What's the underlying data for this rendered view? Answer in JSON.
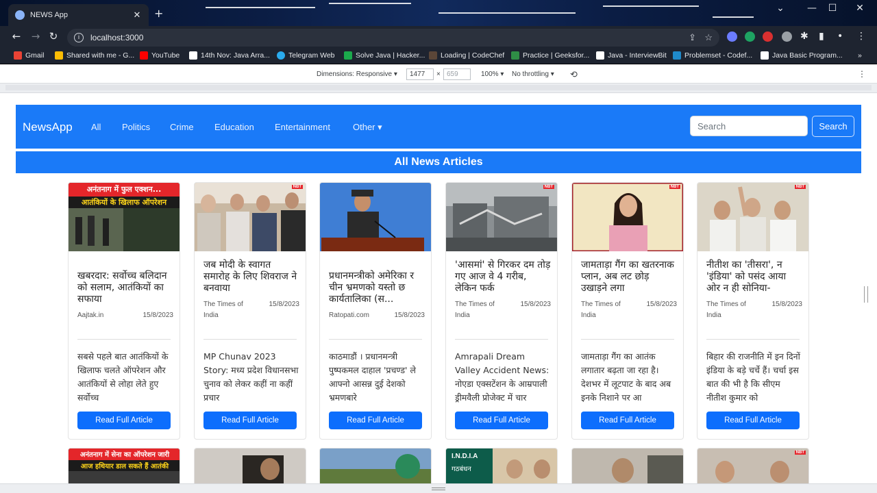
{
  "browser": {
    "tab_title": "NEWS App",
    "url": "localhost:3000",
    "bookmarks": [
      {
        "label": "Gmail",
        "color": "#ea4335"
      },
      {
        "label": "Shared with me - G...",
        "color": "#fbbc04"
      },
      {
        "label": "YouTube",
        "color": "#ff0000"
      },
      {
        "label": "14th Nov: Java Arra...",
        "color": "#ffffff"
      },
      {
        "label": "Telegram Web",
        "color": "#2aabee"
      },
      {
        "label": "Solve Java | Hacker...",
        "color": "#1ba94c"
      },
      {
        "label": "Loading | CodeChef",
        "color": "#5b4638"
      },
      {
        "label": "Practice | Geeksfor...",
        "color": "#2f8d46"
      },
      {
        "label": "Java - InterviewBit",
        "color": "#ffffff"
      },
      {
        "label": "Problemset - Codef...",
        "color": "#1f8acb"
      },
      {
        "label": "Java Basic Program...",
        "color": "#ffffff"
      }
    ]
  },
  "devtools": {
    "dimensions": "Dimensions: Responsive ▾",
    "width": "1477",
    "times": "×",
    "height": "659",
    "zoom": "100% ▾",
    "throttling": "No throttling ▾"
  },
  "navbar": {
    "brand": "NewsApp",
    "links": [
      "All",
      "Politics",
      "Crime",
      "Education",
      "Entertainment",
      "Other ▾"
    ],
    "search_placeholder": "Search",
    "search_button": "Search"
  },
  "heading": "All News Articles",
  "articles": [
    {
      "title": "खबरदार: सर्वोच्च बलिदान को सलाम, आतंकियों का सफाया",
      "source": "Aajtak.in",
      "date": "15/8/2023",
      "description": "सबसे पहले बात आतंकियों के खिलाफ चलते ऑपरेशन और आतंकियों से लोहा लेते हुए सर्वोच्च",
      "button": "Read Full Article",
      "image_caption_1": "अनंतनाग में फुल एक्शन...",
      "image_caption_2": "आतंकियों के खिलाफ ऑपरेशन"
    },
    {
      "title": "जब मोदी के स्वागत समारोह के लिए शिवराज ने बनवाया",
      "source": "The Times of India",
      "date": "15/8/2023",
      "description": "MP Chunav 2023 Story: मध्य प्रदेश विधानसभा चुनाव को लेकर कहीं ना कहीं प्रचार",
      "button": "Read Full Article"
    },
    {
      "title": "प्रधानमन्त्रीको अमेरिका र चीन भ्रमणको यस्तो छ कार्यतालिका (स...",
      "source": "Ratopati.com",
      "date": "15/8/2023",
      "description": "काठमाडौं । प्रधानमन्त्री पुष्पकमल दाहाल 'प्रचण्ड' ले आफ्नो आसन्न दुई देशको भ्रमणबारे",
      "button": "Read Full Article"
    },
    {
      "title": "'आसमां' से गिरकर दम तोड़ गए आज वे 4 गरीब, लेकिन फर्क",
      "source": "The Times of India",
      "date": "15/8/2023",
      "description": "Amrapali Dream Valley Accident News: नोएडा एक्सटेंशन के आम्रपाली ड्रीमवैली प्रोजेक्ट में चार",
      "button": "Read Full Article"
    },
    {
      "title": "जामताड़ा गैंग का खतरनाक प्लान, अब लट छोड़ उखाड़ने लगा",
      "source": "The Times of India",
      "date": "15/8/2023",
      "description": "जामताड़ा गैंग का आतंक लगातार बढ़ता जा रहा है। देशभर में लूटपाट के बाद अब इनके निशाने पर आ",
      "button": "Read Full Article"
    },
    {
      "title": "नीतीश का 'तीसरा', न 'इंडिया' को पसंद आया ओर न ही सोनिया-",
      "source": "The Times of India",
      "date": "15/8/2023",
      "description": "बिहार की राजनीति में इन दिनों इंडिया के बड़े चर्चे हैं। चर्चा इस बात की भी है कि सीएम नीतीश कुमार को",
      "button": "Read Full Article"
    }
  ],
  "second_row": {
    "caption_1": "अनंतनाग में सेना का ऑपरेशन जारी",
    "caption_2": "आज हथियार डाल सकते हैं आतंकी",
    "india_1": "I.N.D.I.A",
    "india_2": "गठबंधन"
  },
  "badge": "NBT"
}
